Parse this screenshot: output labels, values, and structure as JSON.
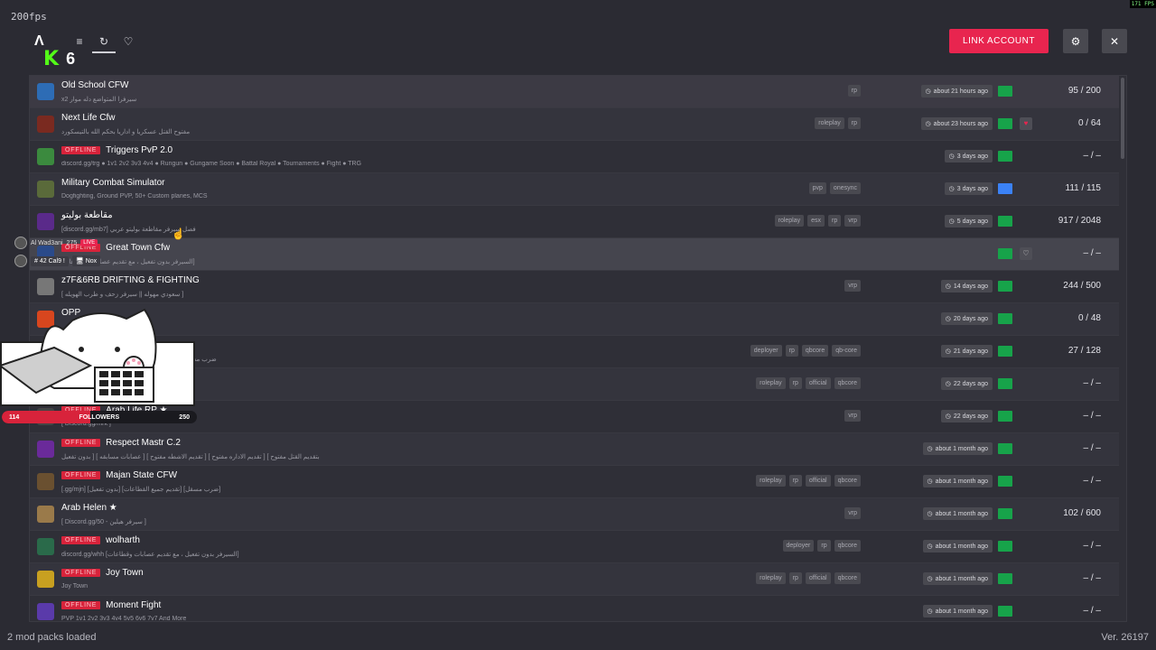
{
  "top": {
    "fps_label": "200fps",
    "fps_corner": "171 FPS",
    "logo": "Λ",
    "menu_icon": "≡",
    "history_icon": "↻",
    "heart_icon": "♡",
    "kick_letter": "K",
    "kick_count": "6",
    "link_account": "LINK ACCOUNT",
    "settings_icon": "⚙",
    "close_icon": "✕"
  },
  "servers": [
    {
      "name": "Old School CFW",
      "offline": false,
      "desc": "x2 سيرفرا المتواضع دله موار",
      "tags": [
        "rp"
      ],
      "time": "about 21 hours ago",
      "discord": false,
      "fav": false,
      "count": "95 / 200",
      "icon_color": "#2d6cb5"
    },
    {
      "name": "Next Life Cfw",
      "offline": false,
      "desc": "مفتوح القتل عسكريا و اداريا بحكم الله بالتيسكورد",
      "tags": [
        "roleplay",
        "rp"
      ],
      "time": "about 23 hours ago",
      "discord": false,
      "fav": true,
      "count": "0 / 64",
      "icon_color": "#7a2a20"
    },
    {
      "name": "Triggers PvP 2.0",
      "offline": true,
      "desc": "discord.gg/trg ● 1v1 2v2 3v3 4v4 ● Rungun ● Gungame Soon ● Battal Royal ● Tournaments ● Fight ● TRG",
      "tags": [],
      "time": "3 days ago",
      "discord": false,
      "fav": false,
      "count": "– / –",
      "icon_color": "#3b8a3e"
    },
    {
      "name": "Military Combat Simulator",
      "offline": false,
      "desc": "Dogfighting, Ground PVP, 50+ Custom planes, MCS",
      "tags": [
        "pvp",
        "onesync"
      ],
      "time": "3 days ago",
      "discord": true,
      "fav": false,
      "count": "111 / 115",
      "icon_color": "#5a6a3a"
    },
    {
      "name": "مقاطعة بوليتو",
      "offline": false,
      "desc": "[discord.gg/mb7] فصل سيرفر مقاطعة بوليتو عربي",
      "tags": [
        "roleplay",
        "esx",
        "rp",
        "vrp"
      ],
      "time": "5 days ago",
      "discord": false,
      "fav": false,
      "count": "917 / 2048",
      "icon_color": "#5a2a8a"
    },
    {
      "name": "Great Town Cfw",
      "offline": true,
      "desc": "[السيرفر بدون تفعيل ، مع تقديم عصابات وقطاعات]",
      "tags": [],
      "time": "",
      "discord": false,
      "fav": false,
      "show_heart": true,
      "count": "– / –",
      "icon_color": "#2a4a8a"
    },
    {
      "name": "z7F&6RB DRIFTING & FIGHTING",
      "offline": false,
      "desc": "[ سعودي مهوله || سيرفر زحف و طرب الهويله ]",
      "tags": [
        "vrp"
      ],
      "time": "14 days ago",
      "discord": false,
      "fav": false,
      "count": "244 / 500",
      "icon_color": "#777777"
    },
    {
      "name": "OPP",
      "offline": false,
      "desc": "",
      "tags": [],
      "time": "20 days ago",
      "discord": false,
      "fav": false,
      "count": "0 / 48",
      "icon_color": "#d8461e"
    },
    {
      "name": "",
      "offline": false,
      "desc": "ضرب مسقل وتنظيم بمسابقات وتقديم على قيادة القطاعات",
      "tags": [
        "deployer",
        "rp",
        "qbcore",
        "qb-core"
      ],
      "time": "21 days ago",
      "discord": false,
      "fav": false,
      "count": "27 / 128",
      "icon_color": "#444444"
    },
    {
      "name": "",
      "offline": false,
      "desc": "[ بدون تفعيل ]",
      "tags": [
        "roleplay",
        "rp",
        "official",
        "qbcore"
      ],
      "time": "22 days ago",
      "discord": false,
      "fav": false,
      "count": "– / –",
      "icon_color": "#444444"
    },
    {
      "name": "Arab Life RP ★",
      "offline": true,
      "desc": "[ Discord.gg/mrk ]",
      "tags": [
        "vrp"
      ],
      "time": "22 days ago",
      "discord": false,
      "fav": false,
      "count": "– / –",
      "icon_color": "#444444"
    },
    {
      "name": "Respect Mastr C.2",
      "offline": true,
      "desc": "بتقديم القتل مفتوح ] [ تقديم الاداره مفتوح ] [ تقديم الاشطه مفتوح ] [ عصابات مسابقه ] [ بدون تفعيل",
      "tags": [],
      "time": "about 1 month ago",
      "discord": false,
      "fav": false,
      "count": "– / –",
      "icon_color": "#6a2a9a"
    },
    {
      "name": "Majan State CFW",
      "offline": true,
      "desc": "[.gg/mjn] [بدون تفعيل] [تقديم جميع القطاعات] [ضرب مسقل]",
      "tags": [
        "roleplay",
        "rp",
        "official",
        "qbcore"
      ],
      "time": "about 1 month ago",
      "discord": false,
      "fav": false,
      "count": "– / –",
      "icon_color": "#6a5030"
    },
    {
      "name": "Arab Helen ★",
      "offline": false,
      "desc": "[ Discord.gg/50 - سيرفر هيلين ]",
      "tags": [
        "vrp"
      ],
      "time": "about 1 month ago",
      "discord": false,
      "fav": false,
      "count": "102 / 600",
      "icon_color": "#9a7a4a"
    },
    {
      "name": "wolharth",
      "offline": true,
      "desc": "discord.gg/whh [السيرفر بدون تفعيل ، مع تقديم عصابات وقطاعات]",
      "tags": [
        "deployer",
        "rp",
        "qbcore"
      ],
      "time": "about 1 month ago",
      "discord": false,
      "fav": false,
      "count": "– / –",
      "icon_color": "#2a6a4a"
    },
    {
      "name": "Joy Town",
      "offline": true,
      "desc": "Joy Town",
      "tags": [
        "roleplay",
        "rp",
        "official",
        "qbcore"
      ],
      "time": "about 1 month ago",
      "discord": false,
      "fav": false,
      "count": "– / –",
      "icon_color": "#c8a020"
    },
    {
      "name": "Moment Fight",
      "offline": true,
      "desc": "PVP 1v1 2v2 3v3 4v4 5v5 6v6 7v7 And More",
      "tags": [],
      "time": "about 1 month ago",
      "discord": false,
      "fav": false,
      "count": "– / –",
      "icon_color": "#5a3aaa"
    }
  ],
  "offline_label": "OFFLINE",
  "footer": {
    "mod_packs": "2 mod packs loaded",
    "version": "Ver. 26197"
  },
  "overlay": {
    "live_user": "Al Wad3ani",
    "live_viewers": "275",
    "live_badge": "LIVE",
    "tag_1": "# 42 Cal9 !",
    "tag_2": "🖥 Nox",
    "followers_label": "FOLLOWERS",
    "followers_current": "114",
    "followers_goal": "250",
    "followers_progress": 0.456
  }
}
